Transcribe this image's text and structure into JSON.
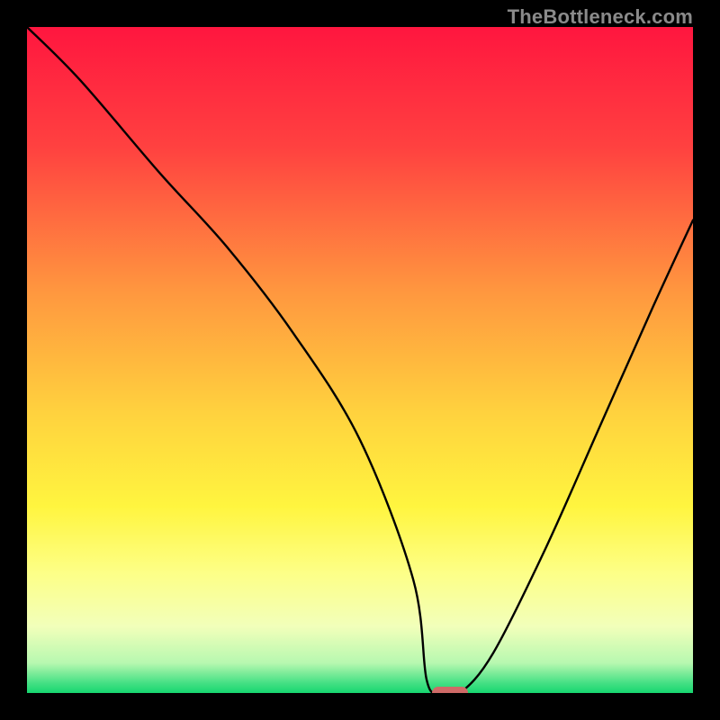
{
  "watermark": "TheBottleneck.com",
  "chart_data": {
    "type": "line",
    "title": "",
    "xlabel": "",
    "ylabel": "",
    "xlim": [
      0,
      100
    ],
    "ylim": [
      0,
      100
    ],
    "grid": false,
    "series": [
      {
        "name": "curve",
        "x": [
          0,
          8,
          20,
          30,
          40,
          50,
          58,
          60,
          62,
          65,
          70,
          78,
          86,
          94,
          100
        ],
        "values": [
          100,
          92,
          78,
          67,
          54,
          38,
          17,
          2,
          0,
          0,
          6,
          22,
          40,
          58,
          71
        ]
      }
    ],
    "marker": {
      "x": 63.5,
      "y": 0
    },
    "background": {
      "type": "vertical-gradient",
      "stops": [
        {
          "pos": 0.0,
          "color": "#ff163f"
        },
        {
          "pos": 0.18,
          "color": "#ff4140"
        },
        {
          "pos": 0.4,
          "color": "#ff983f"
        },
        {
          "pos": 0.58,
          "color": "#ffd23e"
        },
        {
          "pos": 0.72,
          "color": "#fff53f"
        },
        {
          "pos": 0.82,
          "color": "#fdff87"
        },
        {
          "pos": 0.9,
          "color": "#f2ffba"
        },
        {
          "pos": 0.955,
          "color": "#b7f8b0"
        },
        {
          "pos": 0.985,
          "color": "#45e084"
        },
        {
          "pos": 1.0,
          "color": "#16d66f"
        }
      ]
    }
  }
}
